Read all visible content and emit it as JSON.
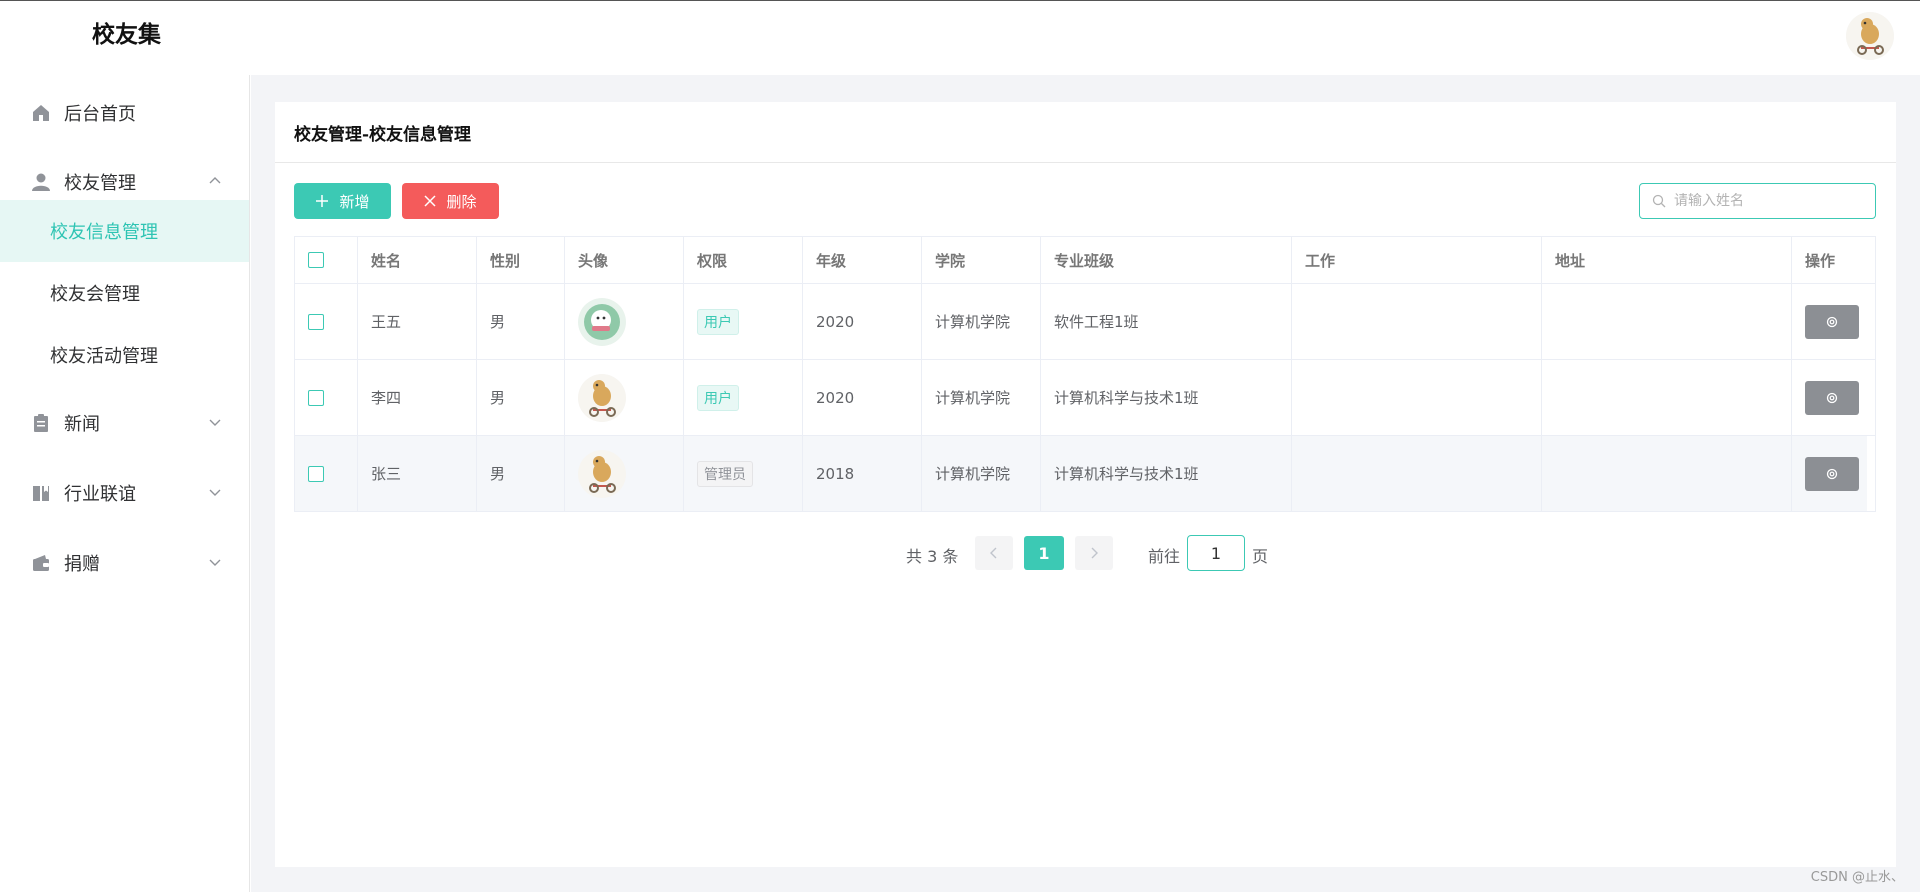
{
  "app": {
    "title": "校友集"
  },
  "sidebar": {
    "items": [
      {
        "label": "后台首页",
        "icon": "home-icon"
      },
      {
        "label": "校友管理",
        "icon": "user-icon",
        "expanded": true,
        "children": [
          {
            "label": "校友信息管理",
            "active": true
          },
          {
            "label": "校友会管理"
          },
          {
            "label": "校友活动管理"
          }
        ]
      },
      {
        "label": "新闻",
        "icon": "clipboard-icon"
      },
      {
        "label": "行业联谊",
        "icon": "book-icon"
      },
      {
        "label": "捐赠",
        "icon": "wallet-icon"
      }
    ]
  },
  "main": {
    "title": "校友管理-校友信息管理",
    "toolbar": {
      "add_label": "新增",
      "delete_label": "删除",
      "search_placeholder": "请输入姓名"
    },
    "table": {
      "columns": [
        "姓名",
        "性别",
        "头像",
        "权限",
        "年级",
        "学院",
        "专业班级",
        "工作",
        "地址",
        "操作"
      ],
      "rows": [
        {
          "name": "王五",
          "gender": "男",
          "role": "用户",
          "grade": "2020",
          "college": "计算机学院",
          "class": "软件工程1班",
          "job": "",
          "address": ""
        },
        {
          "name": "李四",
          "gender": "男",
          "role": "用户",
          "grade": "2020",
          "college": "计算机学院",
          "class": "计算机科学与技术1班",
          "job": "",
          "address": ""
        },
        {
          "name": "张三",
          "gender": "男",
          "role": "管理员",
          "grade": "2018",
          "college": "计算机学院",
          "class": "计算机科学与技术1班",
          "job": "",
          "address": ""
        }
      ]
    },
    "pagination": {
      "total_text": "共 3 条",
      "current_page": "1",
      "goto_label": "前往",
      "goto_value": "1",
      "page_suffix": "页"
    }
  },
  "colors": {
    "accent": "#3cc9b4",
    "danger": "#f45b5b",
    "op_button": "#8c8f94"
  },
  "watermark": "CSDN @止水、"
}
